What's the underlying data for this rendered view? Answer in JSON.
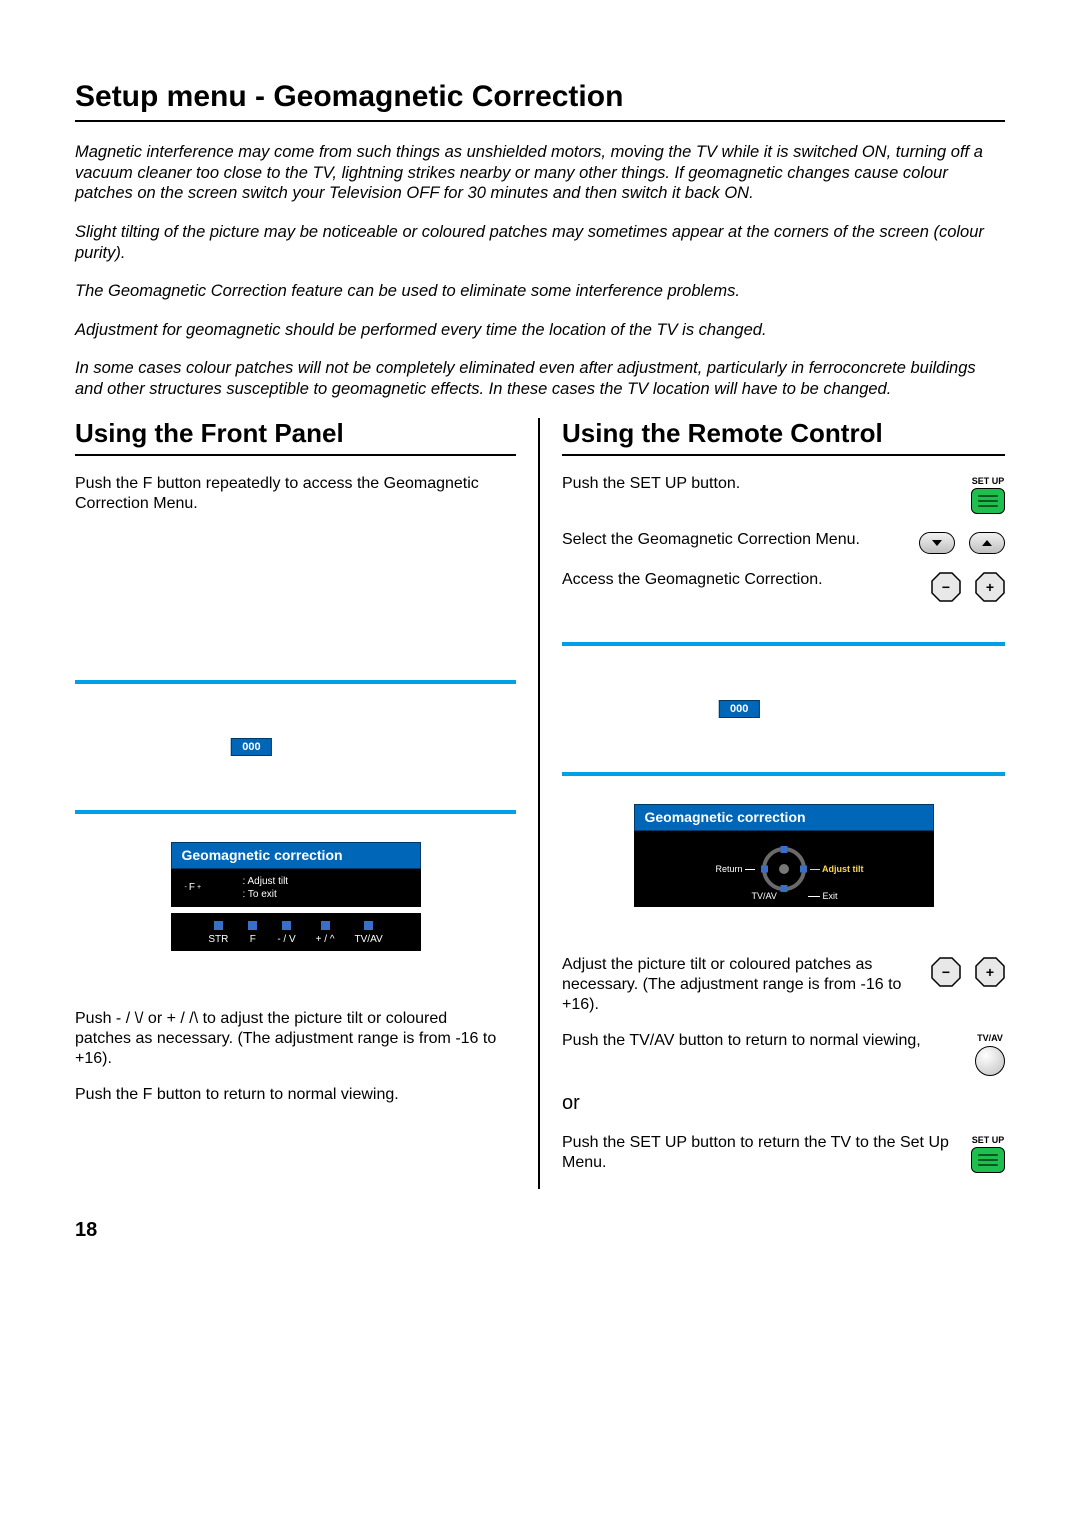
{
  "page": {
    "title": "Setup menu - Geomagnetic Correction",
    "number": "18"
  },
  "intro": {
    "p1": "Magnetic interference may come from such things as unshielded motors, moving the TV while it is switched ON, turning off a vacuum cleaner too close to the TV, lightning strikes nearby or many other things. If geomagnetic changes cause colour patches on the screen switch your Television OFF for 30 minutes and then switch it back ON.",
    "p2": "Slight tilting of the picture may be noticeable or coloured patches may sometimes appear at the corners of the screen (colour purity).",
    "p3": "The Geomagnetic Correction feature can be used to eliminate some interference problems.",
    "p4": "Adjustment for geomagnetic should be performed every time the location of the TV is changed.",
    "p5": "In some cases colour patches will not be completely eliminated even after adjustment, particularly in ferroconcrete buildings and other structures susceptible to geomagnetic effects. In these cases the TV location will have to be changed."
  },
  "left": {
    "heading": "Using the Front Panel",
    "step1": "Push the F button repeatedly to access the Geomagnetic Correction Menu.",
    "tv_value": "000",
    "osd_title": "Geomagnetic correction",
    "osd_left_key": "F",
    "osd_sup_minus": "-",
    "osd_sup_plus": "+",
    "osd_r1": ":   Adjust tilt",
    "osd_r2": ":   To exit",
    "fp_buttons": {
      "b1": "STR",
      "b2": "F",
      "b3": "- / V",
      "b4": "+ / ^",
      "b5": "TV/AV"
    },
    "step2": "Push - / \\/ or + / /\\ to adjust the picture tilt or coloured patches as necessary. (The adjustment range is from -16 to +16).",
    "step3": "Push the F button to return to normal viewing."
  },
  "right": {
    "heading": "Using the Remote Control",
    "step1": "Push the SET UP button.",
    "step2": "Select the Geomagnetic Correction Menu.",
    "step3": "Access the Geomagnetic Correction.",
    "tv_value": "000",
    "osd_title": "Geomagnetic correction",
    "dial_return": "Return",
    "dial_adjust": "Adjust tilt",
    "dial_tvav": "TV/AV",
    "dial_exit": "Exit",
    "step4": "Adjust the picture tilt or coloured patches as necessary. (The adjustment range is from -16 to +16).",
    "step5": "Push the TV/AV button to return to normal viewing,",
    "or": "or",
    "step6": "Push the SET UP button to return the TV to the Set Up Menu.",
    "setup_label": "SET UP",
    "tvav_label": "TV/AV"
  }
}
